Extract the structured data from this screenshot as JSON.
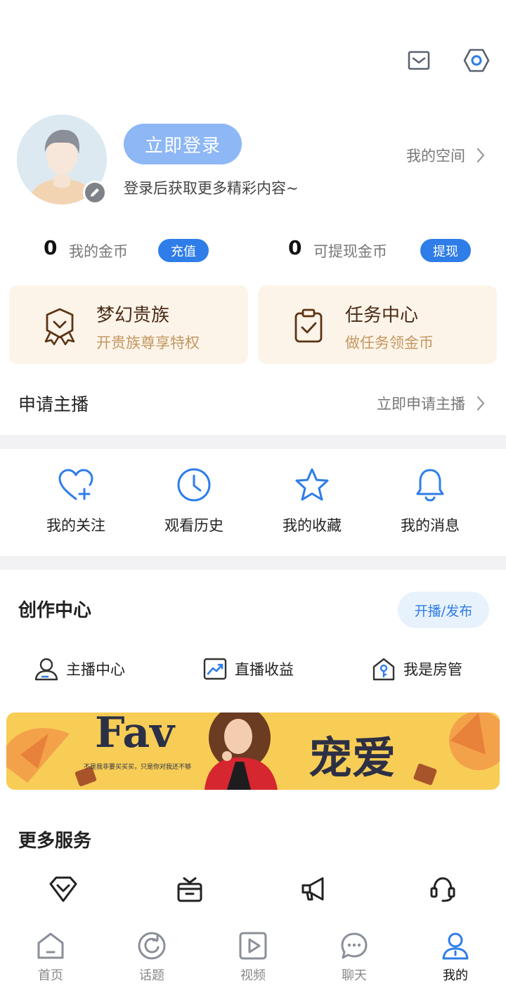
{
  "header": {
    "message_icon": "envelope-icon",
    "settings_icon": "hexagon-gear-icon"
  },
  "profile": {
    "login_label": "立即登录",
    "login_hint": "登录后获取更多精彩内容~",
    "my_space_label": "我的空间"
  },
  "coins": {
    "my_coins_value": "0",
    "my_coins_label": "我的金币",
    "recharge_label": "充值",
    "withdrawable_value": "0",
    "withdrawable_label": "可提现金币",
    "withdraw_label": "提现"
  },
  "cards": [
    {
      "title": "梦幻贵族",
      "subtitle": "开贵族尊享特权",
      "icon": "badge-icon"
    },
    {
      "title": "任务中心",
      "subtitle": "做任务领金币",
      "icon": "clipboard-check-icon"
    }
  ],
  "apply": {
    "title": "申请主播",
    "link_label": "立即申请主播"
  },
  "quick_links": [
    {
      "label": "我的关注",
      "icon": "heart-plus-icon"
    },
    {
      "label": "观看历史",
      "icon": "clock-icon"
    },
    {
      "label": "我的收藏",
      "icon": "star-icon"
    },
    {
      "label": "我的消息",
      "icon": "bell-icon"
    }
  ],
  "creation": {
    "title": "创作中心",
    "publish_label": "开播/发布",
    "items": [
      {
        "label": "主播中心",
        "icon": "anchor-user-icon"
      },
      {
        "label": "直播收益",
        "icon": "trend-chart-icon"
      },
      {
        "label": "我是房管",
        "icon": "house-key-icon"
      }
    ]
  },
  "banner": {
    "headline": "宠爱",
    "latin": "Fav",
    "tagline": "不是我非要买买买，只是你对我还不够"
  },
  "more_services": {
    "title": "更多服务",
    "items": [
      {
        "icon": "diamond-icon"
      },
      {
        "icon": "gift-box-icon"
      },
      {
        "icon": "megaphone-icon"
      },
      {
        "icon": "headset-icon"
      }
    ]
  },
  "bottom_nav": [
    {
      "label": "首页",
      "icon": "home-icon"
    },
    {
      "label": "话题",
      "icon": "refresh-circle-icon"
    },
    {
      "label": "视频",
      "icon": "play-square-icon"
    },
    {
      "label": "聊天",
      "icon": "chat-bubble-icon"
    },
    {
      "label": "我的",
      "icon": "user-icon",
      "active": true
    }
  ],
  "colors": {
    "accent": "#2f7de8",
    "login_button": "#8db7f5",
    "card_bg": "#fdf4e9",
    "card_title": "#4a2c16",
    "card_sub": "#c49761",
    "banner_bg": "#f7cd56"
  }
}
